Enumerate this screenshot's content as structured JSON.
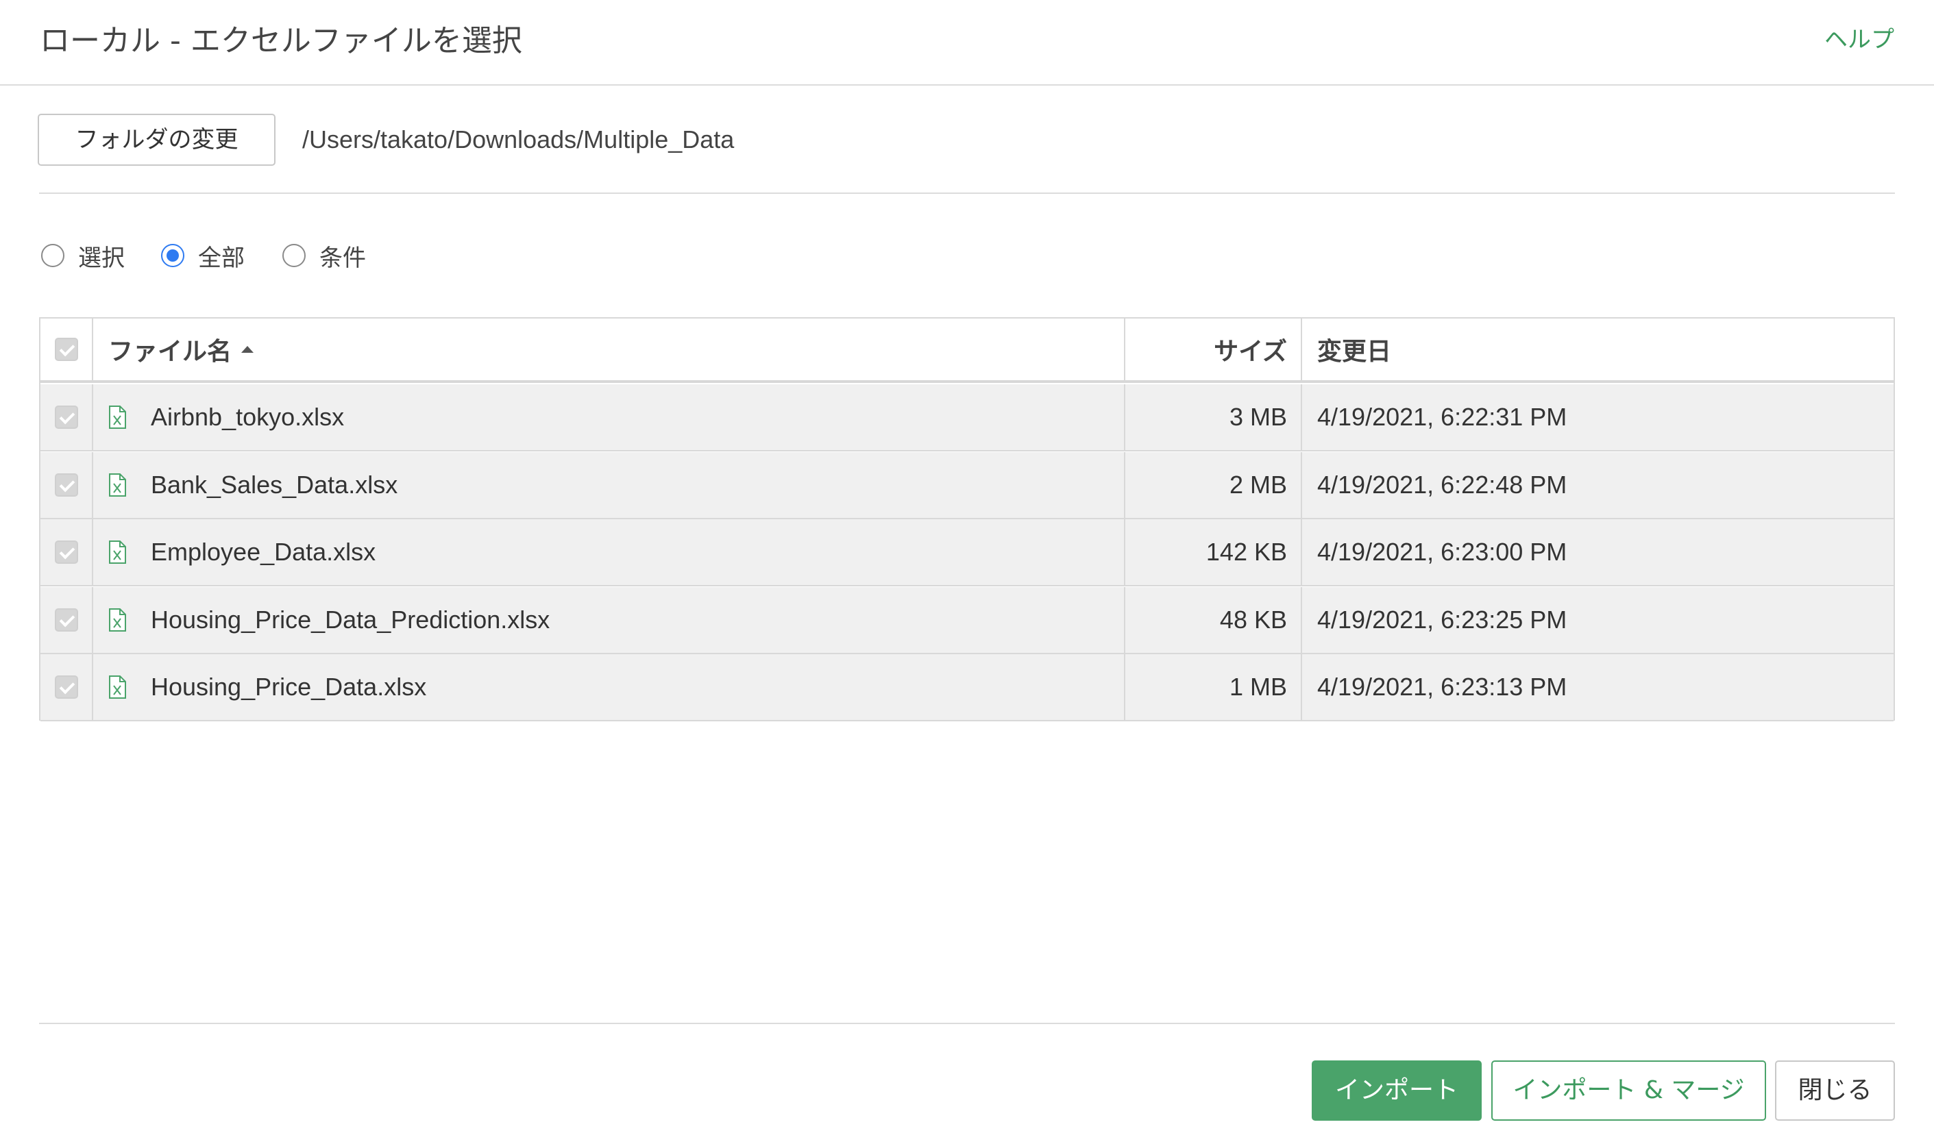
{
  "header": {
    "title": "ローカル - エクセルファイルを選択",
    "help_label": "ヘルプ"
  },
  "folder": {
    "change_label": "フォルダの変更",
    "path": "/Users/takato/Downloads/Multiple_Data"
  },
  "mode": {
    "options": [
      {
        "label": "選択",
        "checked": false
      },
      {
        "label": "全部",
        "checked": true
      },
      {
        "label": "条件",
        "checked": false
      }
    ]
  },
  "table": {
    "columns": {
      "name": "ファイル名",
      "size": "サイズ",
      "modified": "変更日"
    },
    "sort": {
      "column": "name",
      "direction": "ascending"
    },
    "rows": [
      {
        "name": "Airbnb_tokyo.xlsx",
        "size": "3 MB",
        "modified": "4/19/2021, 6:22:31 PM",
        "checked": true
      },
      {
        "name": "Bank_Sales_Data.xlsx",
        "size": "2 MB",
        "modified": "4/19/2021, 6:22:48 PM",
        "checked": true
      },
      {
        "name": "Employee_Data.xlsx",
        "size": "142 KB",
        "modified": "4/19/2021, 6:23:00 PM",
        "checked": true
      },
      {
        "name": "Housing_Price_Data_Prediction.xlsx",
        "size": "48 KB",
        "modified": "4/19/2021, 6:23:25 PM",
        "checked": true
      },
      {
        "name": "Housing_Price_Data.xlsx",
        "size": "1 MB",
        "modified": "4/19/2021, 6:23:13 PM",
        "checked": true
      }
    ]
  },
  "footer": {
    "import_label": "インポート",
    "import_merge_label": "インポート & マージ",
    "close_label": "閉じる"
  },
  "colors": {
    "accent_green": "#4aa36a",
    "radio_blue": "#2f7bf1",
    "row_bg": "#f0f0f0"
  },
  "icons": {
    "file": "excel-file-icon",
    "sort": "sort-ascending-icon"
  }
}
